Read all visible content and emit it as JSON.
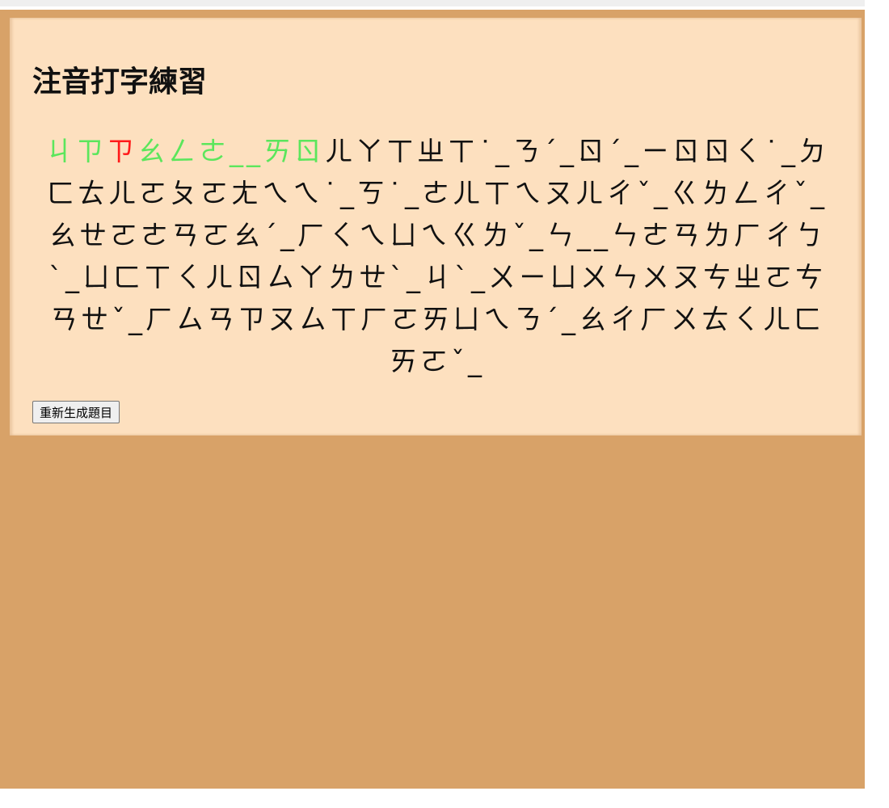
{
  "title": "注音打字練習",
  "regen_button_label": "重新生成題目",
  "colors": {
    "correct": "#5ce65c",
    "wrong": "#ff1a1a",
    "pending": "#111111",
    "panel_bg": "#fde0bf",
    "page_bg": "#d8a268"
  },
  "typed_segments": [
    {
      "text": "ㄐㄗ",
      "state": "correct"
    },
    {
      "text": "ㄗ",
      "state": "wrong"
    },
    {
      "text": "ㄠㄥㄜ__ㄞㄖ",
      "state": "correct"
    }
  ],
  "remaining_text": "ㄦㄚㄒㄓㄒ˙_ㄋˊ_ㄖˊ_ㄧㄖㄖㄑ˙_ㄉㄈㄊㄦㄛㄆㄛㄤㄟㄟ˙_ㄎ˙_ㄜㄦㄒㄟㄡㄦㄔˇ_ㄍㄌㄥㄔˇ_ㄠㄝㄛㄜㄢㄛㄠˊ_ㄏㄑㄟㄩㄟㄍㄌˇ_ㄣ__ㄣㄜㄢㄌㄏㄔㄅ`_ㄩㄈㄒㄑㄦㄖㄙㄚㄌㄝ`_ㄐ`_ㄨㄧㄩㄨㄣㄨㄡㄘㄓㄛㄘㄢㄝˇ_ㄏㄙㄢㄗㄡㄙㄒㄏㄛㄞㄩㄟㄋˊ_ㄠㄔㄏㄨㄊㄑㄦㄈㄞㄛˇ_"
}
